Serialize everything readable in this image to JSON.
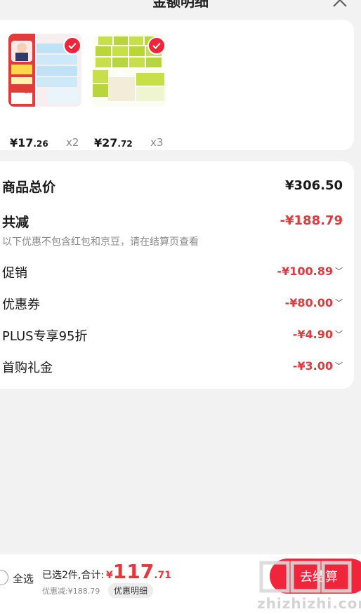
{
  "header": {
    "title": "金额明细"
  },
  "products": [
    {
      "price_int": "¥17",
      "price_dec": ".26",
      "qty": "x2",
      "image_badge": "4.7折"
    },
    {
      "price_int": "¥27",
      "price_dec": ".72",
      "qty": "x3"
    }
  ],
  "summary": {
    "total_label": "商品总价",
    "total_value": "¥306.50",
    "reduce_label": "共减",
    "reduce_value": "-¥188.79",
    "note": "以下优惠不包含红包和京豆，请在结算页查看",
    "rows": [
      {
        "label": "促销",
        "value": "-¥100.89"
      },
      {
        "label": "优惠券",
        "value": "-¥80.00"
      },
      {
        "label": "PLUS专享95折",
        "value": "-¥4.90"
      },
      {
        "label": "首购礼金",
        "value": "-¥3.00"
      }
    ]
  },
  "bottom": {
    "select_all": "全选",
    "selected_text": "已选2件,合计:",
    "currency": "¥",
    "total_int": "117",
    "total_dec": ".71",
    "discount_text": "优惠减:¥188.79",
    "detail_tag": "优惠明细",
    "checkout_label": "去结算"
  },
  "watermark": {
    "url": "zhizhizhi.com"
  },
  "colors": {
    "accent": "#e4393c",
    "button": "#f0253b",
    "background": "#f2f2f2"
  }
}
